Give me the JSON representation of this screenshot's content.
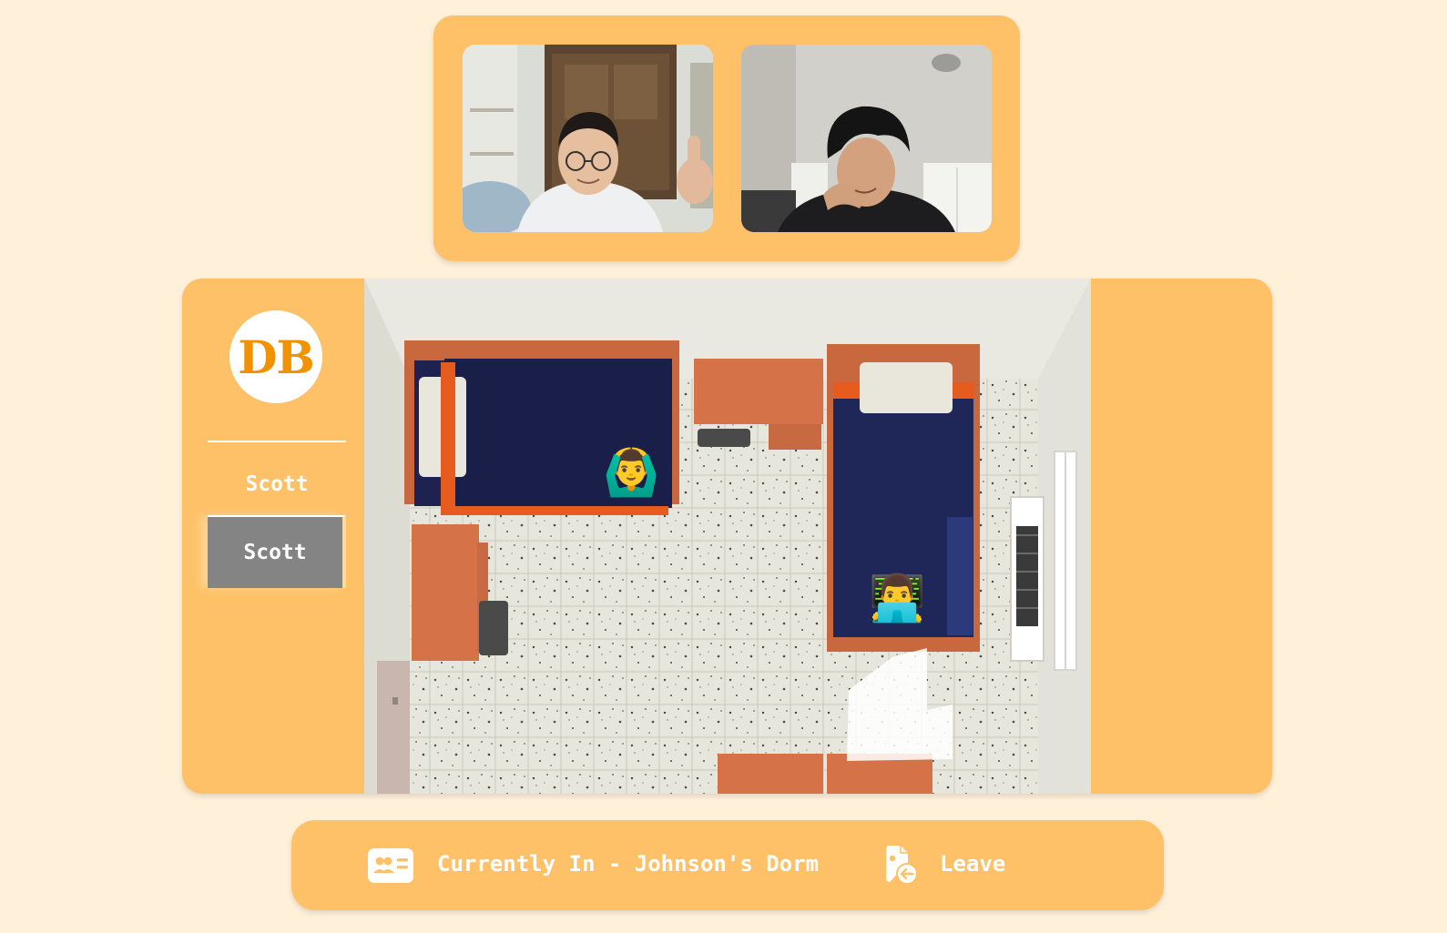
{
  "video_call": {
    "participants": [
      {
        "name": "participant-1"
      },
      {
        "name": "participant-2"
      }
    ]
  },
  "sidebar": {
    "logo_text": "DB",
    "users": [
      {
        "label": "Scott",
        "active": false
      },
      {
        "label": "Scott",
        "active": true
      }
    ]
  },
  "room": {
    "avatars": [
      {
        "emoji": "🙆‍♂️",
        "icon": "person-gesturing-ok"
      },
      {
        "emoji": "👨‍💻",
        "icon": "man-technologist"
      }
    ]
  },
  "bottom_bar": {
    "status_text": "Currently In - Johnson's Dorm",
    "leave_label": "Leave"
  },
  "colors": {
    "page_bg": "#fff0d9",
    "panel": "#fec167",
    "accent": "#f29200",
    "active_item": "#848484"
  },
  "icons": [
    "room-card-icon",
    "leave-door-icon"
  ]
}
